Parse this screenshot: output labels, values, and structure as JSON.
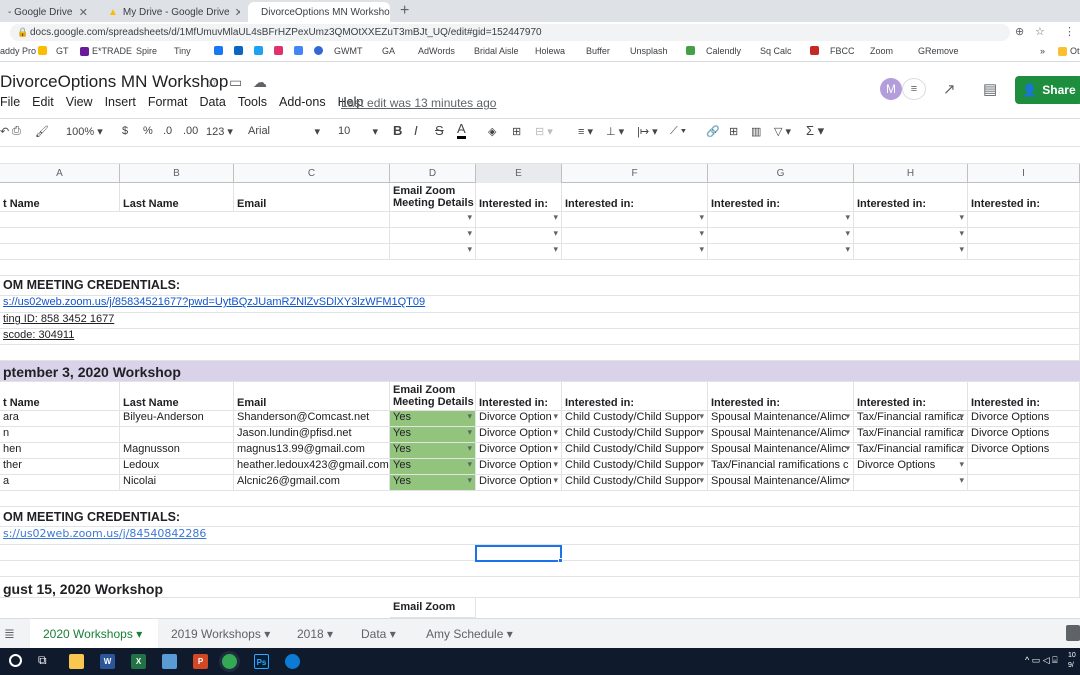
{
  "browser": {
    "tabs": [
      {
        "label": "- Google Drive"
      },
      {
        "label": "My Drive - Google Drive"
      },
      {
        "label": "DivorceOptions MN Workshop -"
      }
    ],
    "url": "docs.google.com/spreadsheets/d/1MfUmuvMlaUL4sBFrHZPexUmz3QMOtXXEZuT3mBJt_UQ/edit#gid=152447970",
    "bookmarks": [
      "addy Pro",
      "GT",
      "E*TRADE",
      "Spire",
      "Tiny",
      "GWMT",
      "GA",
      "AdWords",
      "Bridal Aisle",
      "Holewa",
      "Buffer",
      "Unsplash",
      "Calendly",
      "Sq Calc",
      "FBCC",
      "Zoom",
      "GRemove"
    ],
    "bookmark_more": "»",
    "bookmark_other": "Ot"
  },
  "doc": {
    "title": "DivorceOptions MN Workshop",
    "menu": [
      "File",
      "Edit",
      "View",
      "Insert",
      "Format",
      "Data",
      "Tools",
      "Add-ons",
      "Help"
    ],
    "last_edit": "Last edit was 13 minutes ago",
    "avatar_letter": "M",
    "share_label": "Share"
  },
  "toolbar": {
    "zoom": "100%",
    "currency": "$",
    "percent": "%",
    "dec_less": ".0",
    "dec_more": ".00",
    "format_more": "123",
    "font": "Arial",
    "font_size": "10",
    "bold": "B",
    "italic": "I",
    "strike": "S",
    "textcolor": "A",
    "sum": "Σ"
  },
  "columns": [
    "A",
    "B",
    "C",
    "D",
    "E",
    "F",
    "G",
    "H",
    "I"
  ],
  "rows": {
    "header1": {
      "a": "t Name",
      "b": "Last Name",
      "c": "Email",
      "d": "Email Zoom Meeting Details",
      "e": "Interested in:",
      "f": "Interested in:",
      "g": "Interested in:",
      "h": "Interested in:",
      "i": "Interested in:"
    },
    "zoom1_title": "OM MEETING CREDENTIALS:",
    "zoom1_link": "s://us02web.zoom.us/j/85834521677?pwd=UytBQzJUamRZNlZvSDlXY3lzWFM1QT09",
    "zoom1_meeting": "ting ID: 858 3452 1677",
    "zoom1_passcode": "scode: 304911",
    "section1": "ptember 3, 2020 Workshop",
    "header2": {
      "a": "t Name",
      "b": "Last Name",
      "c": "Email",
      "d": "Email Zoom Meeting Details",
      "e": "Interested in:",
      "f": "Interested in:",
      "g": "Interested in:",
      "h": "Interested in:",
      "i": "Interested in:"
    },
    "people": [
      {
        "a": "ara",
        "b": "Bilyeu-Anderson",
        "c": "Shanderson@Comcast.net",
        "d": "Yes",
        "e": "Divorce Option",
        "f": "Child Custody/Child Suppor",
        "g": "Spousal Maintenance/Alimc",
        "h": "Tax/Financial ramifica",
        "i": "Divorce Options"
      },
      {
        "a": "n",
        "b": "",
        "c": "Jason.lundin@pfisd.net",
        "d": "Yes",
        "e": "Divorce Option",
        "f": "Child Custody/Child Suppor",
        "g": "Spousal Maintenance/Alimc",
        "h": "Tax/Financial ramifica",
        "i": "Divorce Options"
      },
      {
        "a": "hen",
        "b": "Magnusson",
        "c": "magnus13.99@gmail.com",
        "d": "Yes",
        "e": "Divorce Option",
        "f": "Child Custody/Child Suppor",
        "g": "Spousal Maintenance/Alimc",
        "h": "Tax/Financial ramifica",
        "i": "Divorce Options"
      },
      {
        "a": "ther",
        "b": "Ledoux",
        "c": "heather.ledoux423@gmail.com",
        "d": "Yes",
        "e": "Divorce Option",
        "f": "Child Custody/Child Suppor",
        "g": "Tax/Financial ramifications c",
        "h": "Divorce Options",
        "i": ""
      },
      {
        "a": "a",
        "b": "Nicolai",
        "c": "Alcnic26@gmail.com",
        "d": "Yes",
        "e": "Divorce Option",
        "f": "Child Custody/Child Suppor",
        "g": "Spousal Maintenance/Alimc",
        "h": "",
        "i": ""
      }
    ],
    "zoom2_title": "OM MEETING CREDENTIALS:",
    "zoom2_link": "s://us02web.zoom.us/j/84540842286",
    "section2": "gust 15, 2020 Workshop",
    "header3_d": "Email Zoom"
  },
  "sheets": [
    "2020 Workshops",
    "2019 Workshops",
    "2018",
    "Data",
    "Amy Schedule"
  ],
  "colors": {
    "share": "#1e8e3e",
    "yes": "#93c47d",
    "band": "#d9d2e9",
    "link": "#1155cc"
  }
}
